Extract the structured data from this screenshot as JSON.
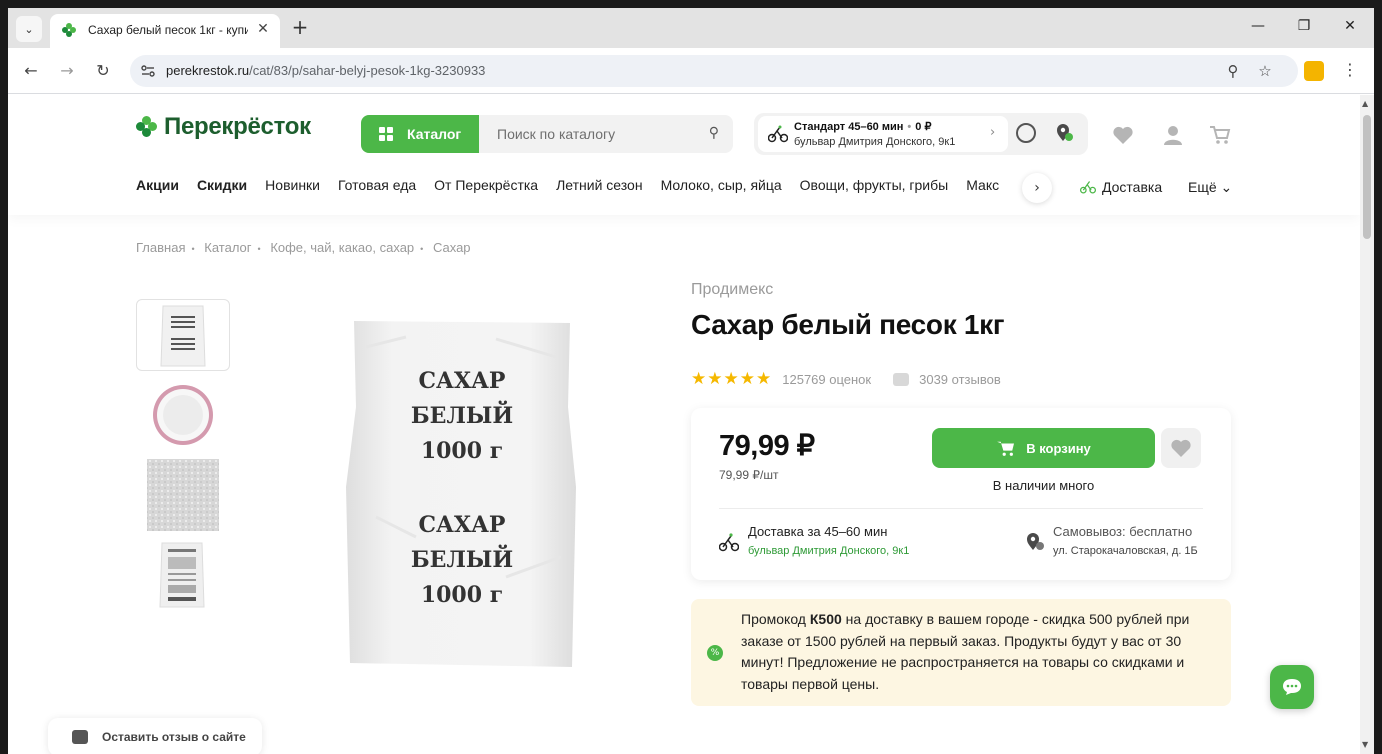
{
  "browser": {
    "tab_title": "Сахар белый песок 1кг - купит",
    "url_host": "perekrestok.ru",
    "url_path": "/cat/83/p/sahar-belyj-pesok-1kg-3230933"
  },
  "header": {
    "logo_text": "Перекрёсток",
    "catalog_label": "Каталог",
    "search_placeholder": "Поиск по каталогу",
    "delivery_type": "Стандарт 45–60 мин",
    "delivery_price": "0 ₽",
    "delivery_address": "бульвар Дмитрия Донского, 9к1"
  },
  "nav": {
    "items": [
      "Акции",
      "Скидки",
      "Новинки",
      "Готовая еда",
      "От Перекрёстка",
      "Летний сезон",
      "Молоко, сыр, яйца",
      "Овощи, фрукты, грибы",
      "Макс"
    ],
    "delivery_label": "Доставка",
    "more_label": "Ещё"
  },
  "breadcrumbs": [
    "Главная",
    "Каталог",
    "Кофе, чай, какао, сахар",
    "Сахар"
  ],
  "product": {
    "brand": "Продимекс",
    "title": "Сахар белый песок 1кг",
    "ratings_count": "125769 оценок",
    "reviews_count": "3039 отзывов",
    "rating_stars": 5,
    "price": "79,99 ₽",
    "unit_price": "79,99 ₽/шт",
    "cart_label": "В корзину",
    "stock_text": "В наличии много",
    "bag_text": [
      "САХАР",
      "БЕЛЫЙ",
      "1000 г"
    ]
  },
  "delivery_options": {
    "delivery_title": "Доставка за 45–60 мин",
    "delivery_address": "бульвар Дмитрия Донского, 9к1",
    "pickup_title": "Самовывоз: бесплатно",
    "pickup_address": "ул. Старокачаловская, д. 1Б"
  },
  "promo": {
    "prefix": "Промокод ",
    "code": "К500",
    "text": " на доставку в вашем городе - скидка 500 рублей при заказе от 1500 рублей на первый заказ. Продукты будут у вас от 30 минут! Предложение не распространяется на товары со скидками и товары первой цены."
  },
  "feedback_label": "Оставить отзыв о сайте",
  "colors": {
    "accent": "#4cb748",
    "brand_dark": "#1d5e2e",
    "promo_bg": "#fdf6e2",
    "star": "#f5b800"
  }
}
